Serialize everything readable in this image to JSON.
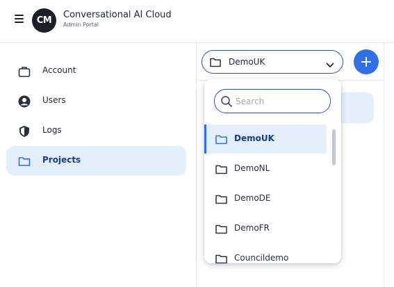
{
  "header": {
    "title": "Conversational AI Cloud",
    "subtitle": "Admin Portal",
    "logo_text": "CM"
  },
  "sidebar": {
    "items": [
      {
        "label": "Account",
        "icon": "briefcase-icon",
        "active": false
      },
      {
        "label": "Users",
        "icon": "user-circle-icon",
        "active": false
      },
      {
        "label": "Logs",
        "icon": "shield-icon",
        "active": false
      },
      {
        "label": "Projects",
        "icon": "folder-icon",
        "active": true
      }
    ]
  },
  "project_select": {
    "value": "DemoUK"
  },
  "dropdown": {
    "search_placeholder": "Search",
    "options": [
      {
        "label": "DemoUK",
        "selected": true
      },
      {
        "label": "DemoNL",
        "selected": false
      },
      {
        "label": "DemoDE",
        "selected": false
      },
      {
        "label": "DemoFR",
        "selected": false
      },
      {
        "label": "Councildemo",
        "selected": false
      }
    ]
  },
  "colors": {
    "accent": "#2f6fe8",
    "selected_bg": "#e4effc",
    "border_active": "#2c4fb3"
  }
}
